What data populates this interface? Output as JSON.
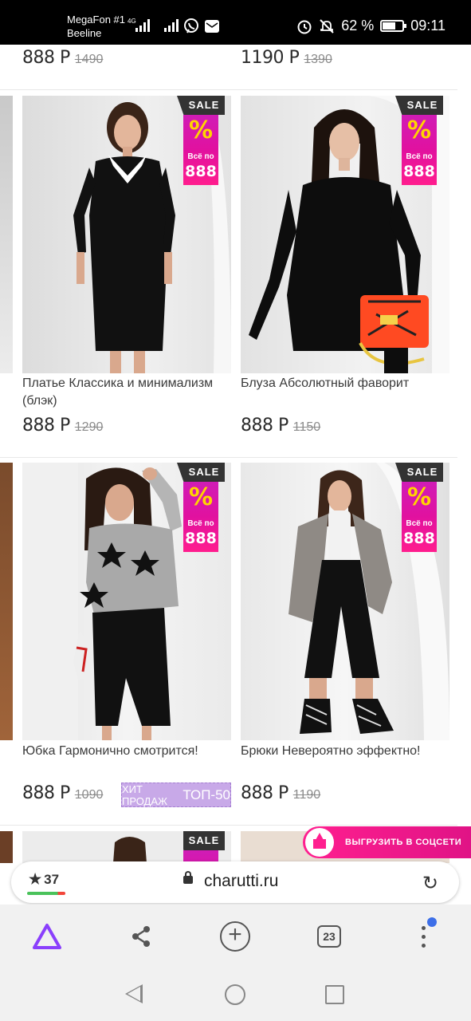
{
  "status": {
    "carrier1": "MegaFon #1",
    "carrier2": "Beeline",
    "net": "4G",
    "battery": "62 %",
    "time": "09:11"
  },
  "top_row": {
    "left_price": "888 Р",
    "left_old": "1490",
    "right_price": "1190 Р",
    "right_old": "1390"
  },
  "sale_badge": {
    "label": "SALE",
    "percent": "%",
    "small": "Всё по",
    "price": "888"
  },
  "products": [
    {
      "name": "Платье Классика и минимализм (блэк)",
      "price": "888 Р",
      "old": "1290"
    },
    {
      "name": "Блуза Абсолютный фаворит",
      "price": "888 Р",
      "old": "1150"
    },
    {
      "name": "Юбка Гармонично смотрится!",
      "price": "888 Р",
      "old": "1090"
    },
    {
      "name": "Брюки Невероятно эффектно!",
      "price": "888 Р",
      "old": "1190"
    }
  ],
  "hit_badge": {
    "text": "ХИТ ПРОДАЖ",
    "top": "ТОП-50"
  },
  "share_button": {
    "label": "ВЫГРУЗИТЬ В СОЦСЕТИ"
  },
  "browser": {
    "rating": "37",
    "url": "charutti.ru",
    "tab_count": "23"
  },
  "colors": {
    "sale_magenta": "#e1119f",
    "sale_yellow": "#ffd500",
    "hit_purple": "#c8a9e8",
    "share_pink": "#ff1f8f",
    "alice_purple": "#8a3ffc"
  }
}
